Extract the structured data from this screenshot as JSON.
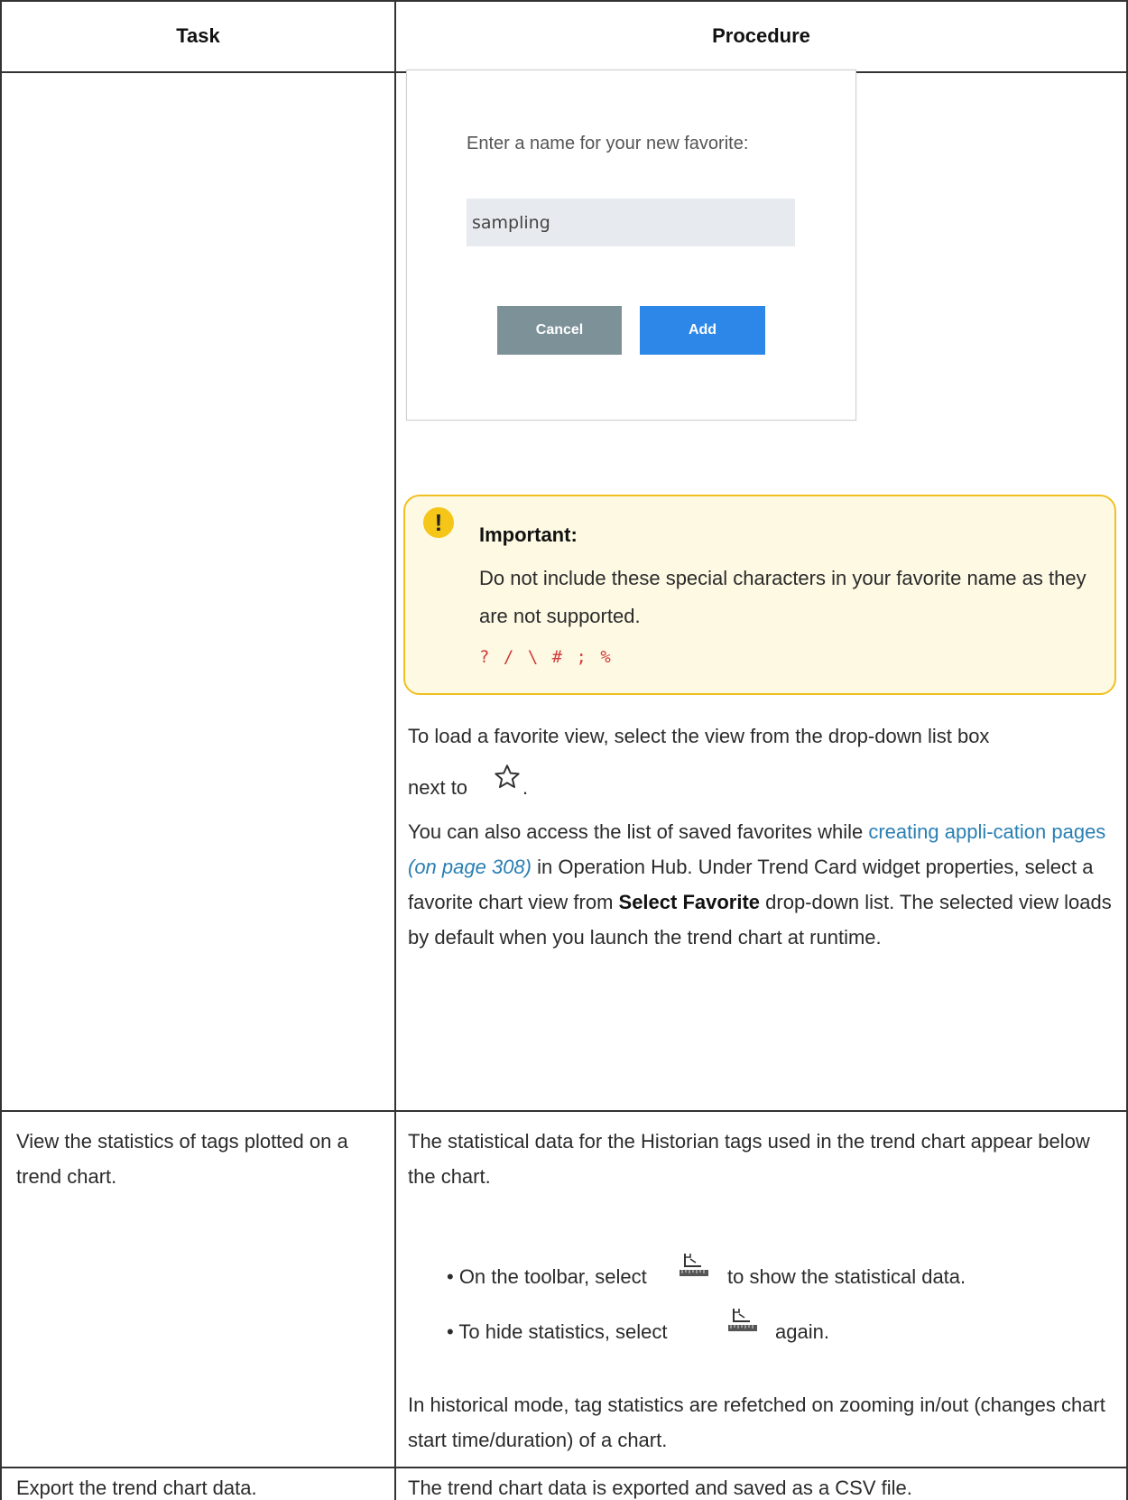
{
  "table": {
    "headers": {
      "task": "Task",
      "procedure": "Procedure"
    }
  },
  "dialog": {
    "prompt": "Enter a name for your new favorite:",
    "input_value": "sampling",
    "cancel_label": "Cancel",
    "add_label": "Add"
  },
  "note": {
    "title": "Important:",
    "body": "Do not include these special characters in your favorite name as they are not supported.",
    "chars": "? / \\ # ; %"
  },
  "row1": {
    "load_text": "To load a favorite view, select the view from the drop-down list box",
    "load_text2": "next to",
    "load_text2_end": ".",
    "star_icon": "star-outline-icon",
    "access_pre": "You can also access the list of saved favorites while ",
    "access_link": "creating appli-cation pages",
    "access_page": "(on page 308)",
    "access_post": " in Operation Hub. Under Trend Card widget properties, select a favorite chart view from ",
    "access_bold": "Select Favorite",
    "access_end": " drop-down list. The selected view loads by default when you launch the trend chart at runtime."
  },
  "row2": {
    "task": "View the statistics of tags plotted on a trend chart.",
    "intro": "The statistical data for the Historian tags used in the trend chart appear below the chart.",
    "bullet1_pre": "• On the toolbar, select",
    "bullet1_post": "to show the statistical data.",
    "bullet2_pre": "• To hide statistics, select",
    "bullet2_post": "again.",
    "stats_icon": "statistics-ruler-icon",
    "historical": "In historical mode, tag statistics are refetched on zooming in/out (changes chart start time/duration) of a chart."
  },
  "row3": {
    "task": "Export the trend chart data.",
    "procedure": "The trend chart data is exported and saved as a CSV file."
  }
}
